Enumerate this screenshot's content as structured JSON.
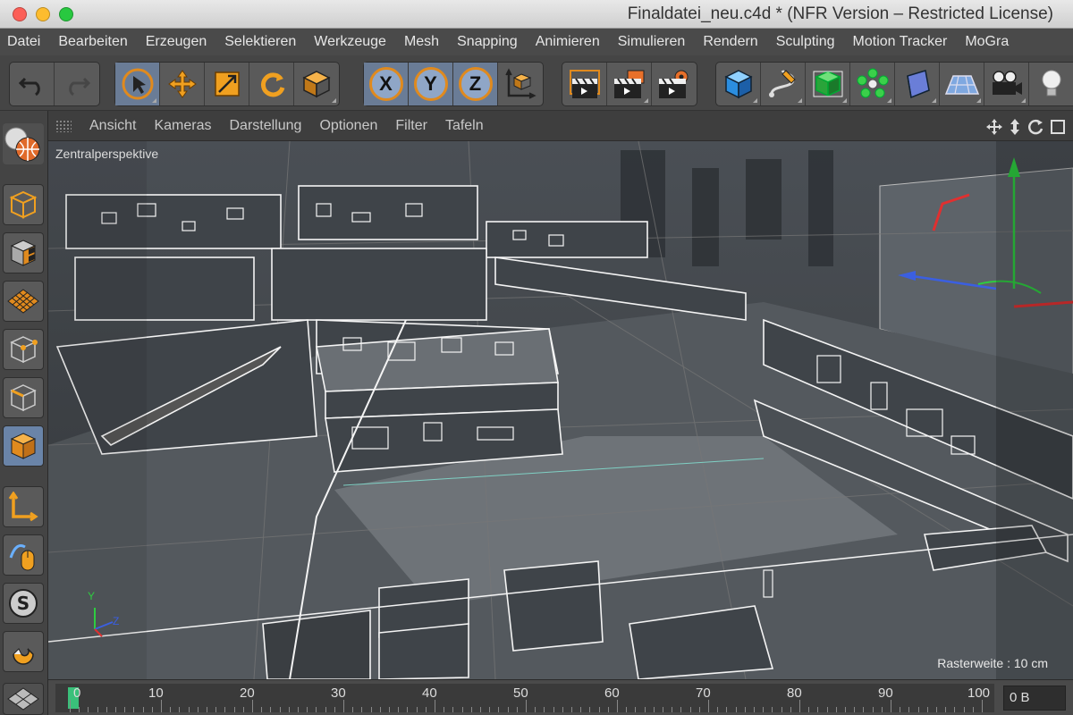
{
  "window": {
    "title": "Finaldatei_neu.c4d * (NFR Version – Restricted License)"
  },
  "menu": {
    "items": [
      "Datei",
      "Bearbeiten",
      "Erzeugen",
      "Selektieren",
      "Werkzeuge",
      "Mesh",
      "Snapping",
      "Animieren",
      "Simulieren",
      "Rendern",
      "Sculpting",
      "Motion Tracker",
      "MoGra"
    ]
  },
  "toolbar": {
    "axis_x": "X",
    "axis_y": "Y",
    "axis_z": "Z"
  },
  "viewport_menu": {
    "items": [
      "Ansicht",
      "Kameras",
      "Darstellung",
      "Optionen",
      "Filter",
      "Tafeln"
    ]
  },
  "viewport": {
    "label": "Zentralperspektive",
    "raster": "Rasterweite : 10 cm",
    "axis_y": "Y",
    "axis_z": "Z"
  },
  "timeline": {
    "ticks": [
      "0",
      "10",
      "20",
      "30",
      "40",
      "50",
      "60",
      "70",
      "80",
      "90",
      "100"
    ],
    "frame": "0 B"
  },
  "colors": {
    "accent_orange": "#e08a1e",
    "selection_blue": "#6a84a8",
    "playhead_green": "#3ac07a"
  }
}
